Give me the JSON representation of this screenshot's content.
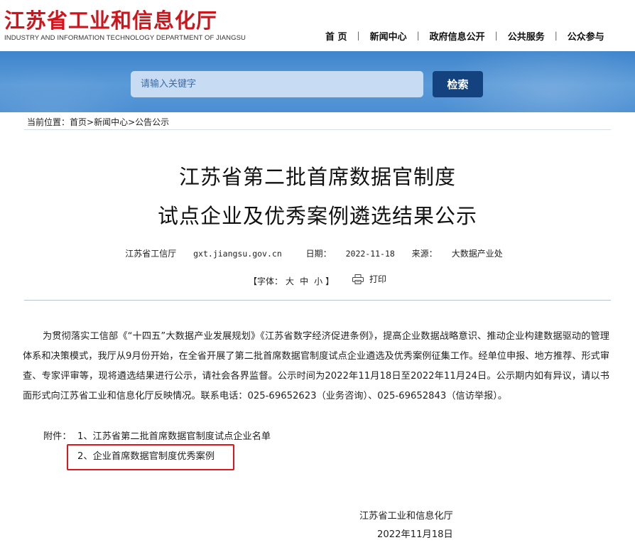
{
  "header": {
    "logo_cn": "江苏省工业和信息化厅",
    "logo_en": "INDUSTRY AND INFORMATION TECHNOLOGY DEPARTMENT OF JIANGSU",
    "nav": [
      {
        "label": "首 页"
      },
      {
        "label": "新闻中心"
      },
      {
        "label": "政府信息公开"
      },
      {
        "label": "公共服务"
      },
      {
        "label": "公众参与"
      }
    ],
    "nav_separator": "|"
  },
  "search": {
    "placeholder": "请输入关键字",
    "button_label": "检索"
  },
  "breadcrumb": {
    "prefix": "当前位置：",
    "items": [
      "首页",
      "新闻中心",
      "公告公示"
    ],
    "separator": ">"
  },
  "article": {
    "title_line1": "江苏省第二批首席数据官制度",
    "title_line2": "试点企业及优秀案例遴选结果公示",
    "meta": {
      "publisher": "江苏省工信厅",
      "site": "gxt.jiangsu.gov.cn",
      "date_label": "日期：",
      "date": "2022-11-18",
      "source_label": "来源：",
      "source": "大数据产业处"
    },
    "font_size": {
      "prefix": "【字体：",
      "large": "大",
      "medium": "中",
      "small": "小",
      "suffix": "】"
    },
    "print_label": "打印",
    "body": "为贯彻落实工信部《“十四五”大数据产业发展规划》《江苏省数字经济促进条例》，提高企业数据战略意识、推动企业构建数据驱动的管理体系和决策模式，我厅从9月份开始，在全省开展了第二批首席数据官制度试点企业遴选及优秀案例征集工作。经单位申报、地方推荐、形式审查、专家评审等，现将遴选结果进行公示，请社会各界监督。公示时间为2022年11月18日至2022年11月24日。公示期内如有异议，请以书面形式向江苏省工业和信息化厅反映情况。联系电话：025-69652623（业务咨询）、025-69652843（信访举报）。",
    "attachments_label": "附件：",
    "attachments": [
      "1、江苏省第二批首席数据官制度试点企业名单",
      "2、企业首席数据官制度优秀案例"
    ],
    "signature": "江苏省工业和信息化厅",
    "signature_date": "2022年11月18日"
  },
  "colors": {
    "logo_red": "#d0141c",
    "band_blue": "#4b8ed2",
    "search_button": "#13427f",
    "highlight_red": "#e0161d"
  }
}
